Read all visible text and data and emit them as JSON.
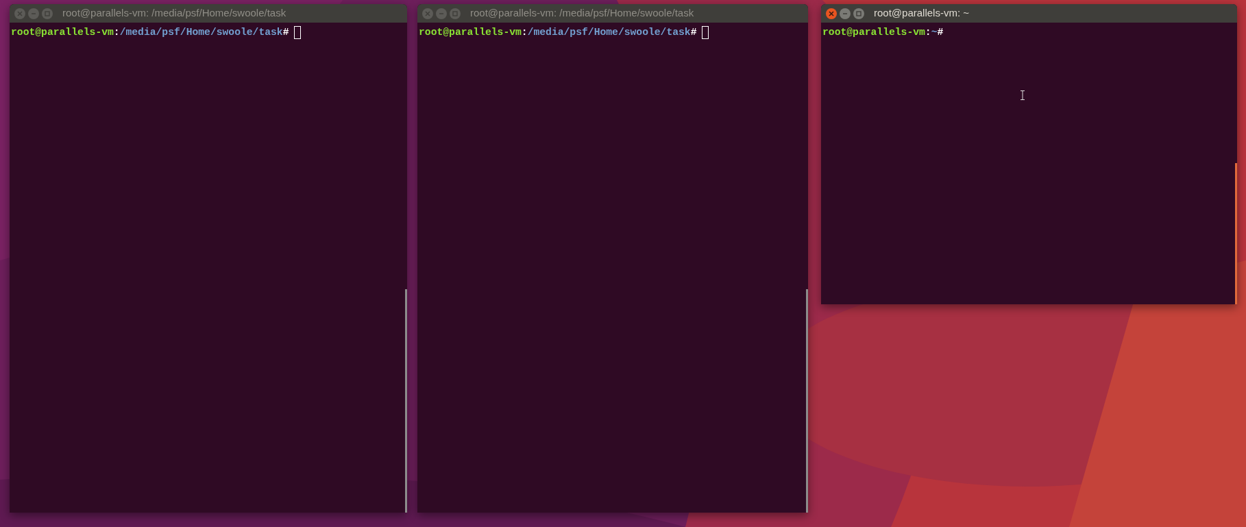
{
  "windows": [
    {
      "title": "root@parallels-vm: /media/psf/Home/swoole/task",
      "active": false,
      "prompt": {
        "user": "root@parallels-vm",
        "separator": ":",
        "path": "/media/psf/Home/swoole/task",
        "symbol": "#"
      },
      "cursor": true
    },
    {
      "title": "root@parallels-vm: /media/psf/Home/swoole/task",
      "active": false,
      "prompt": {
        "user": "root@parallels-vm",
        "separator": ":",
        "path": "/media/psf/Home/swoole/task",
        "symbol": "#"
      },
      "cursor": true
    },
    {
      "title": "root@parallels-vm: ~",
      "active": true,
      "prompt": {
        "user": "root@parallels-vm",
        "separator": ":",
        "path": "~",
        "symbol": "#"
      },
      "cursor": false
    }
  ]
}
